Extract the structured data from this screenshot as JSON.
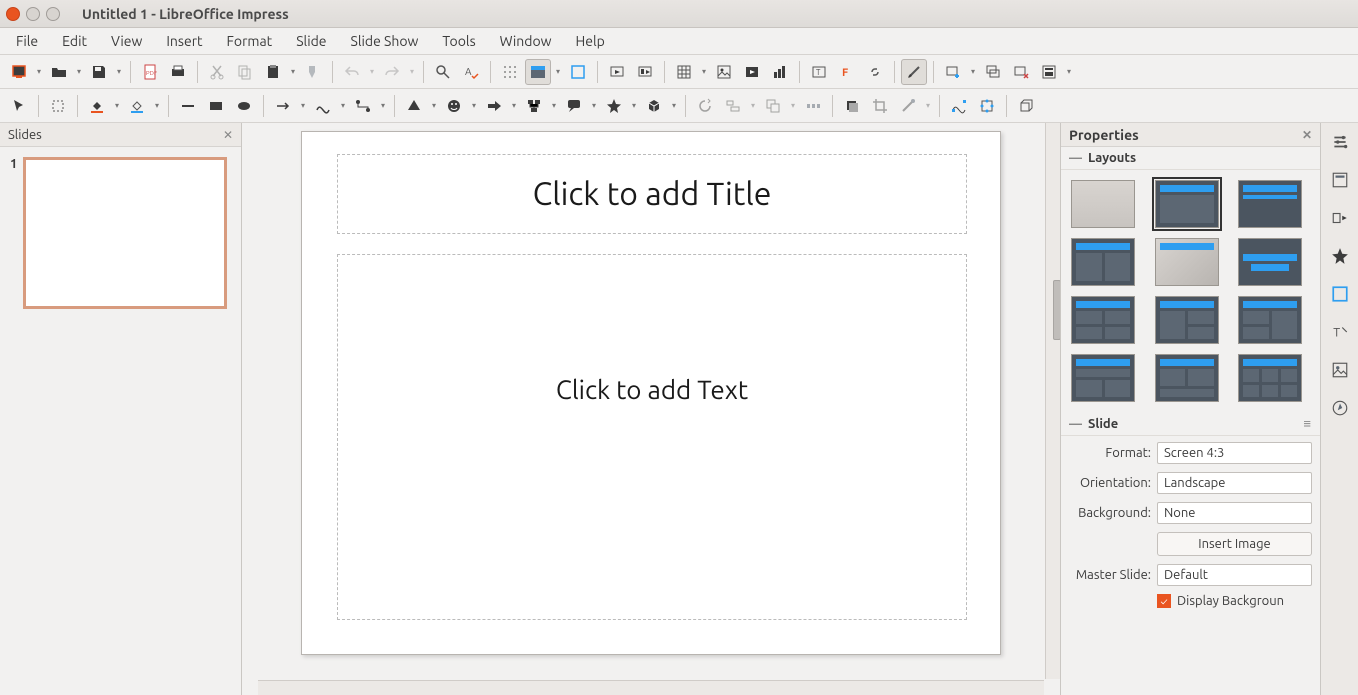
{
  "window": {
    "title": "Untitled 1 - LibreOffice Impress"
  },
  "menu": [
    "File",
    "Edit",
    "View",
    "Insert",
    "Format",
    "Slide",
    "Slide Show",
    "Tools",
    "Window",
    "Help"
  ],
  "slides_panel": {
    "title": "Slides",
    "items": [
      {
        "num": "1"
      }
    ]
  },
  "canvas": {
    "title_ph": "Click to add Title",
    "text_ph": "Click to add Text"
  },
  "properties": {
    "header": "Properties",
    "layouts_label": "Layouts",
    "slide_label": "Slide",
    "format_label": "Format:",
    "format_val": "Screen 4:3",
    "orientation_label": "Orientation:",
    "orientation_val": "Landscape",
    "background_label": "Background:",
    "background_val": "None",
    "insert_image": "Insert Image",
    "master_label": "Master Slide:",
    "master_val": "Default",
    "display_bg": "Display Backgroun"
  }
}
